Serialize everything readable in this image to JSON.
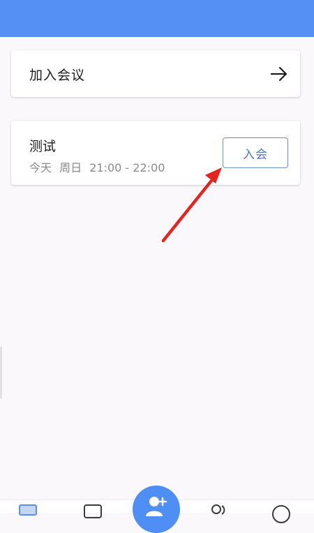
{
  "join_meeting": {
    "label": "加入会议",
    "icon": "arrow-right-icon"
  },
  "meeting": {
    "title": "测试",
    "day": "今天",
    "weekday": "周日",
    "time_range": "21:00 - 22:00",
    "join_label": "入会"
  },
  "bottom_nav": {
    "items": [
      {
        "icon": "video-meeting-icon"
      },
      {
        "icon": "chat-icon"
      },
      {
        "icon": "add-contact-icon"
      },
      {
        "icon": "contacts-icon"
      },
      {
        "icon": "profile-icon"
      }
    ]
  },
  "colors": {
    "header": "#5591f5",
    "background": "#faf8fb",
    "join_button_border": "#6a8fc4",
    "join_button_text": "#4f78b7",
    "annotation_arrow": "#e8231f",
    "fab": "#4f8ef5"
  }
}
